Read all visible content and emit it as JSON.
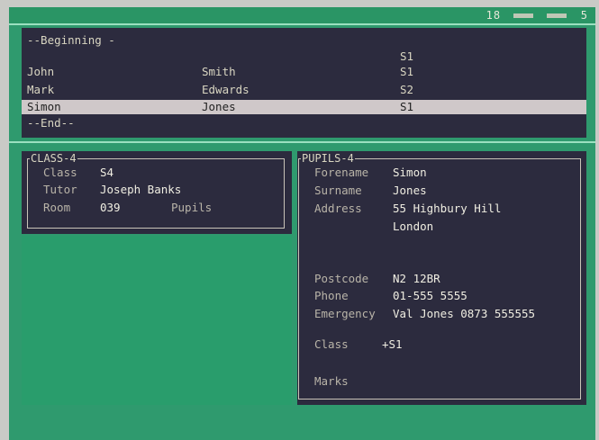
{
  "status_bar": {
    "indicator_1": "18",
    "indicator_2": "5"
  },
  "list": {
    "rows": [
      {
        "forename": "--Beginning -",
        "surname": "",
        "class": ""
      },
      {
        "forename": "",
        "surname": "",
        "class": "S1"
      },
      {
        "forename": "John",
        "surname": "Smith",
        "class": "S1"
      },
      {
        "forename": "Mark",
        "surname": "Edwards",
        "class": "S2"
      },
      {
        "forename": "Simon",
        "surname": "Jones",
        "class": "S1"
      },
      {
        "forename": "--End--",
        "surname": "",
        "class": ""
      }
    ]
  },
  "class_panel": {
    "title": "CLASS-4",
    "class_label": "Class",
    "class_value": "S4",
    "tutor_label": "Tutor",
    "tutor_value": "Joseph Banks",
    "room_label": "Room",
    "room_value": "039",
    "pupils_label": "Pupils"
  },
  "pupils_panel": {
    "title": "PUPILS-4",
    "forename_label": "Forename",
    "forename_value": "Simon",
    "surname_label": "Surname",
    "surname_value": "Jones",
    "address_label": "Address",
    "address_line1": "55 Highbury Hill",
    "address_line2": "London",
    "postcode_label": "Postcode",
    "postcode_value": "N2 12BR",
    "phone_label": "Phone",
    "phone_value": "01-555 5555",
    "emergency_label": "Emergency",
    "emergency_value": "Val Jones 0873 555555",
    "class_label": "Class",
    "class_value": "+S1",
    "marks_label": "Marks"
  }
}
